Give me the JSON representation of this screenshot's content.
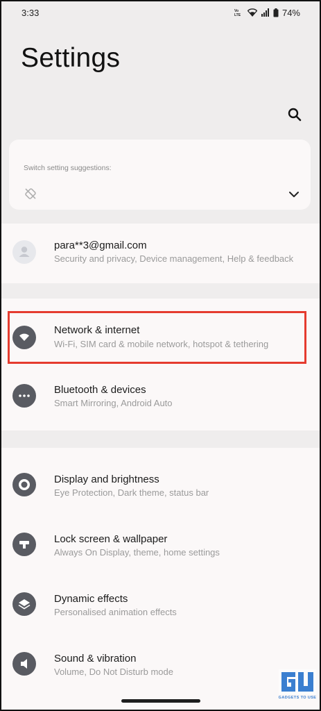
{
  "status_bar": {
    "time": "3:33",
    "network_label": "VoLTE",
    "battery": "74%"
  },
  "header": {
    "title": "Settings",
    "search_icon": "search-icon"
  },
  "suggestions": {
    "label": "Switch setting suggestions:",
    "icon": "auto-rotate-off-icon",
    "expand_icon": "chevron-down-icon"
  },
  "account": {
    "title": "para**3@gmail.com",
    "subtitle": "Security and privacy, Device management, Help & feedback",
    "icon": "avatar-icon"
  },
  "connectivity": [
    {
      "title": "Network & internet",
      "subtitle": "Wi-Fi, SIM card & mobile network, hotspot & tethering",
      "icon": "wifi-icon",
      "highlighted": true
    },
    {
      "title": "Bluetooth & devices",
      "subtitle": "Smart Mirroring, Android Auto",
      "icon": "more-dots-icon"
    }
  ],
  "personalization": [
    {
      "title": "Display and brightness",
      "subtitle": "Eye Protection, Dark theme, status bar",
      "icon": "display-icon"
    },
    {
      "title": "Lock screen & wallpaper",
      "subtitle": "Always On Display, theme, home settings",
      "icon": "lock-screen-icon"
    },
    {
      "title": "Dynamic effects",
      "subtitle": "Personalised animation effects",
      "icon": "layers-icon"
    },
    {
      "title": "Sound & vibration",
      "subtitle": "Volume, Do Not Disturb mode",
      "icon": "speaker-icon"
    }
  ],
  "watermark": {
    "text": "GADGETS TO USE"
  },
  "colors": {
    "background": "#efeded",
    "card": "#fbf8f8",
    "icon_dark": "#595b62",
    "highlight": "#e53b2f",
    "subtitle": "#9a9a9a"
  }
}
